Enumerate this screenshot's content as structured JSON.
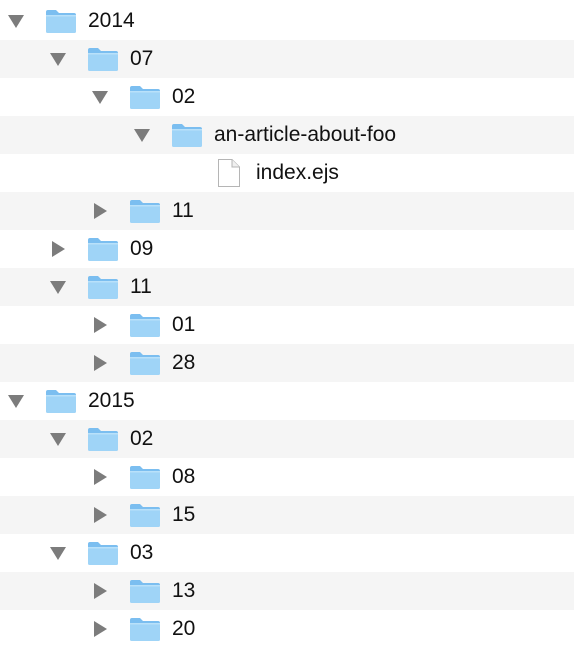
{
  "colors": {
    "row_stripe": "#f5f5f5",
    "row_plain": "#ffffff",
    "folder_body": "#9fd4f7",
    "folder_tab": "#7bbef0",
    "disclosure": "#7c7c7c",
    "text": "#111111"
  },
  "rows": [
    {
      "label": "2014",
      "depth": 0,
      "state": "expanded",
      "icon": "folder-icon"
    },
    {
      "label": "07",
      "depth": 1,
      "state": "expanded",
      "icon": "folder-icon"
    },
    {
      "label": "02",
      "depth": 2,
      "state": "expanded",
      "icon": "folder-icon"
    },
    {
      "label": "an-article-about-foo",
      "depth": 3,
      "state": "expanded",
      "icon": "folder-icon"
    },
    {
      "label": "index.ejs",
      "depth": 4,
      "state": "leaf",
      "icon": "file-icon"
    },
    {
      "label": "11",
      "depth": 2,
      "state": "collapsed",
      "icon": "folder-icon"
    },
    {
      "label": "09",
      "depth": 1,
      "state": "collapsed",
      "icon": "folder-icon"
    },
    {
      "label": "11",
      "depth": 1,
      "state": "expanded",
      "icon": "folder-icon"
    },
    {
      "label": "01",
      "depth": 2,
      "state": "collapsed",
      "icon": "folder-icon"
    },
    {
      "label": "28",
      "depth": 2,
      "state": "collapsed",
      "icon": "folder-icon"
    },
    {
      "label": "2015",
      "depth": 0,
      "state": "expanded",
      "icon": "folder-icon"
    },
    {
      "label": "02",
      "depth": 1,
      "state": "expanded",
      "icon": "folder-icon"
    },
    {
      "label": "08",
      "depth": 2,
      "state": "collapsed",
      "icon": "folder-icon"
    },
    {
      "label": "15",
      "depth": 2,
      "state": "collapsed",
      "icon": "folder-icon"
    },
    {
      "label": "03",
      "depth": 1,
      "state": "expanded",
      "icon": "folder-icon"
    },
    {
      "label": "13",
      "depth": 2,
      "state": "collapsed",
      "icon": "folder-icon"
    },
    {
      "label": "20",
      "depth": 2,
      "state": "collapsed",
      "icon": "folder-icon"
    }
  ]
}
